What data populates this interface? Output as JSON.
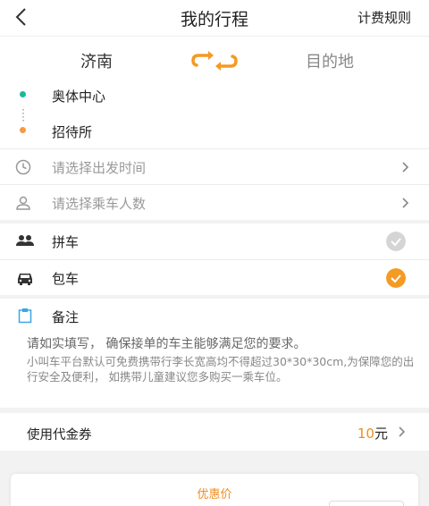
{
  "header": {
    "title": "我的行程",
    "rules_label": "计费规则"
  },
  "route": {
    "from": "济南",
    "to": "目的地"
  },
  "trip": {
    "start": "奥体中心",
    "end": "招待所",
    "time_placeholder": "请选择出发时间",
    "passengers_placeholder": "请选择乘车人数"
  },
  "ride_options": [
    {
      "label": "拼车",
      "selected": false
    },
    {
      "label": "包车",
      "selected": true
    }
  ],
  "note": {
    "title": "备注",
    "main": "请如实填写， 确保接单的车主能够满足您的要求。",
    "sub": "小叫车平台默认可免费携带行李长宽高均不得超过30*30*30cm,为保障您的出行安全及便利， 如携带儿童建议您多购买一乘车位。"
  },
  "coupon": {
    "label": "使用代金券",
    "amount": "10",
    "unit": "元"
  },
  "bottom": {
    "discount_label": "优惠价"
  },
  "colors": {
    "accent": "#f08c1c",
    "start_dot": "#1bb99a",
    "end_dot": "#f59a45",
    "unchecked": "#d5d5d5"
  }
}
